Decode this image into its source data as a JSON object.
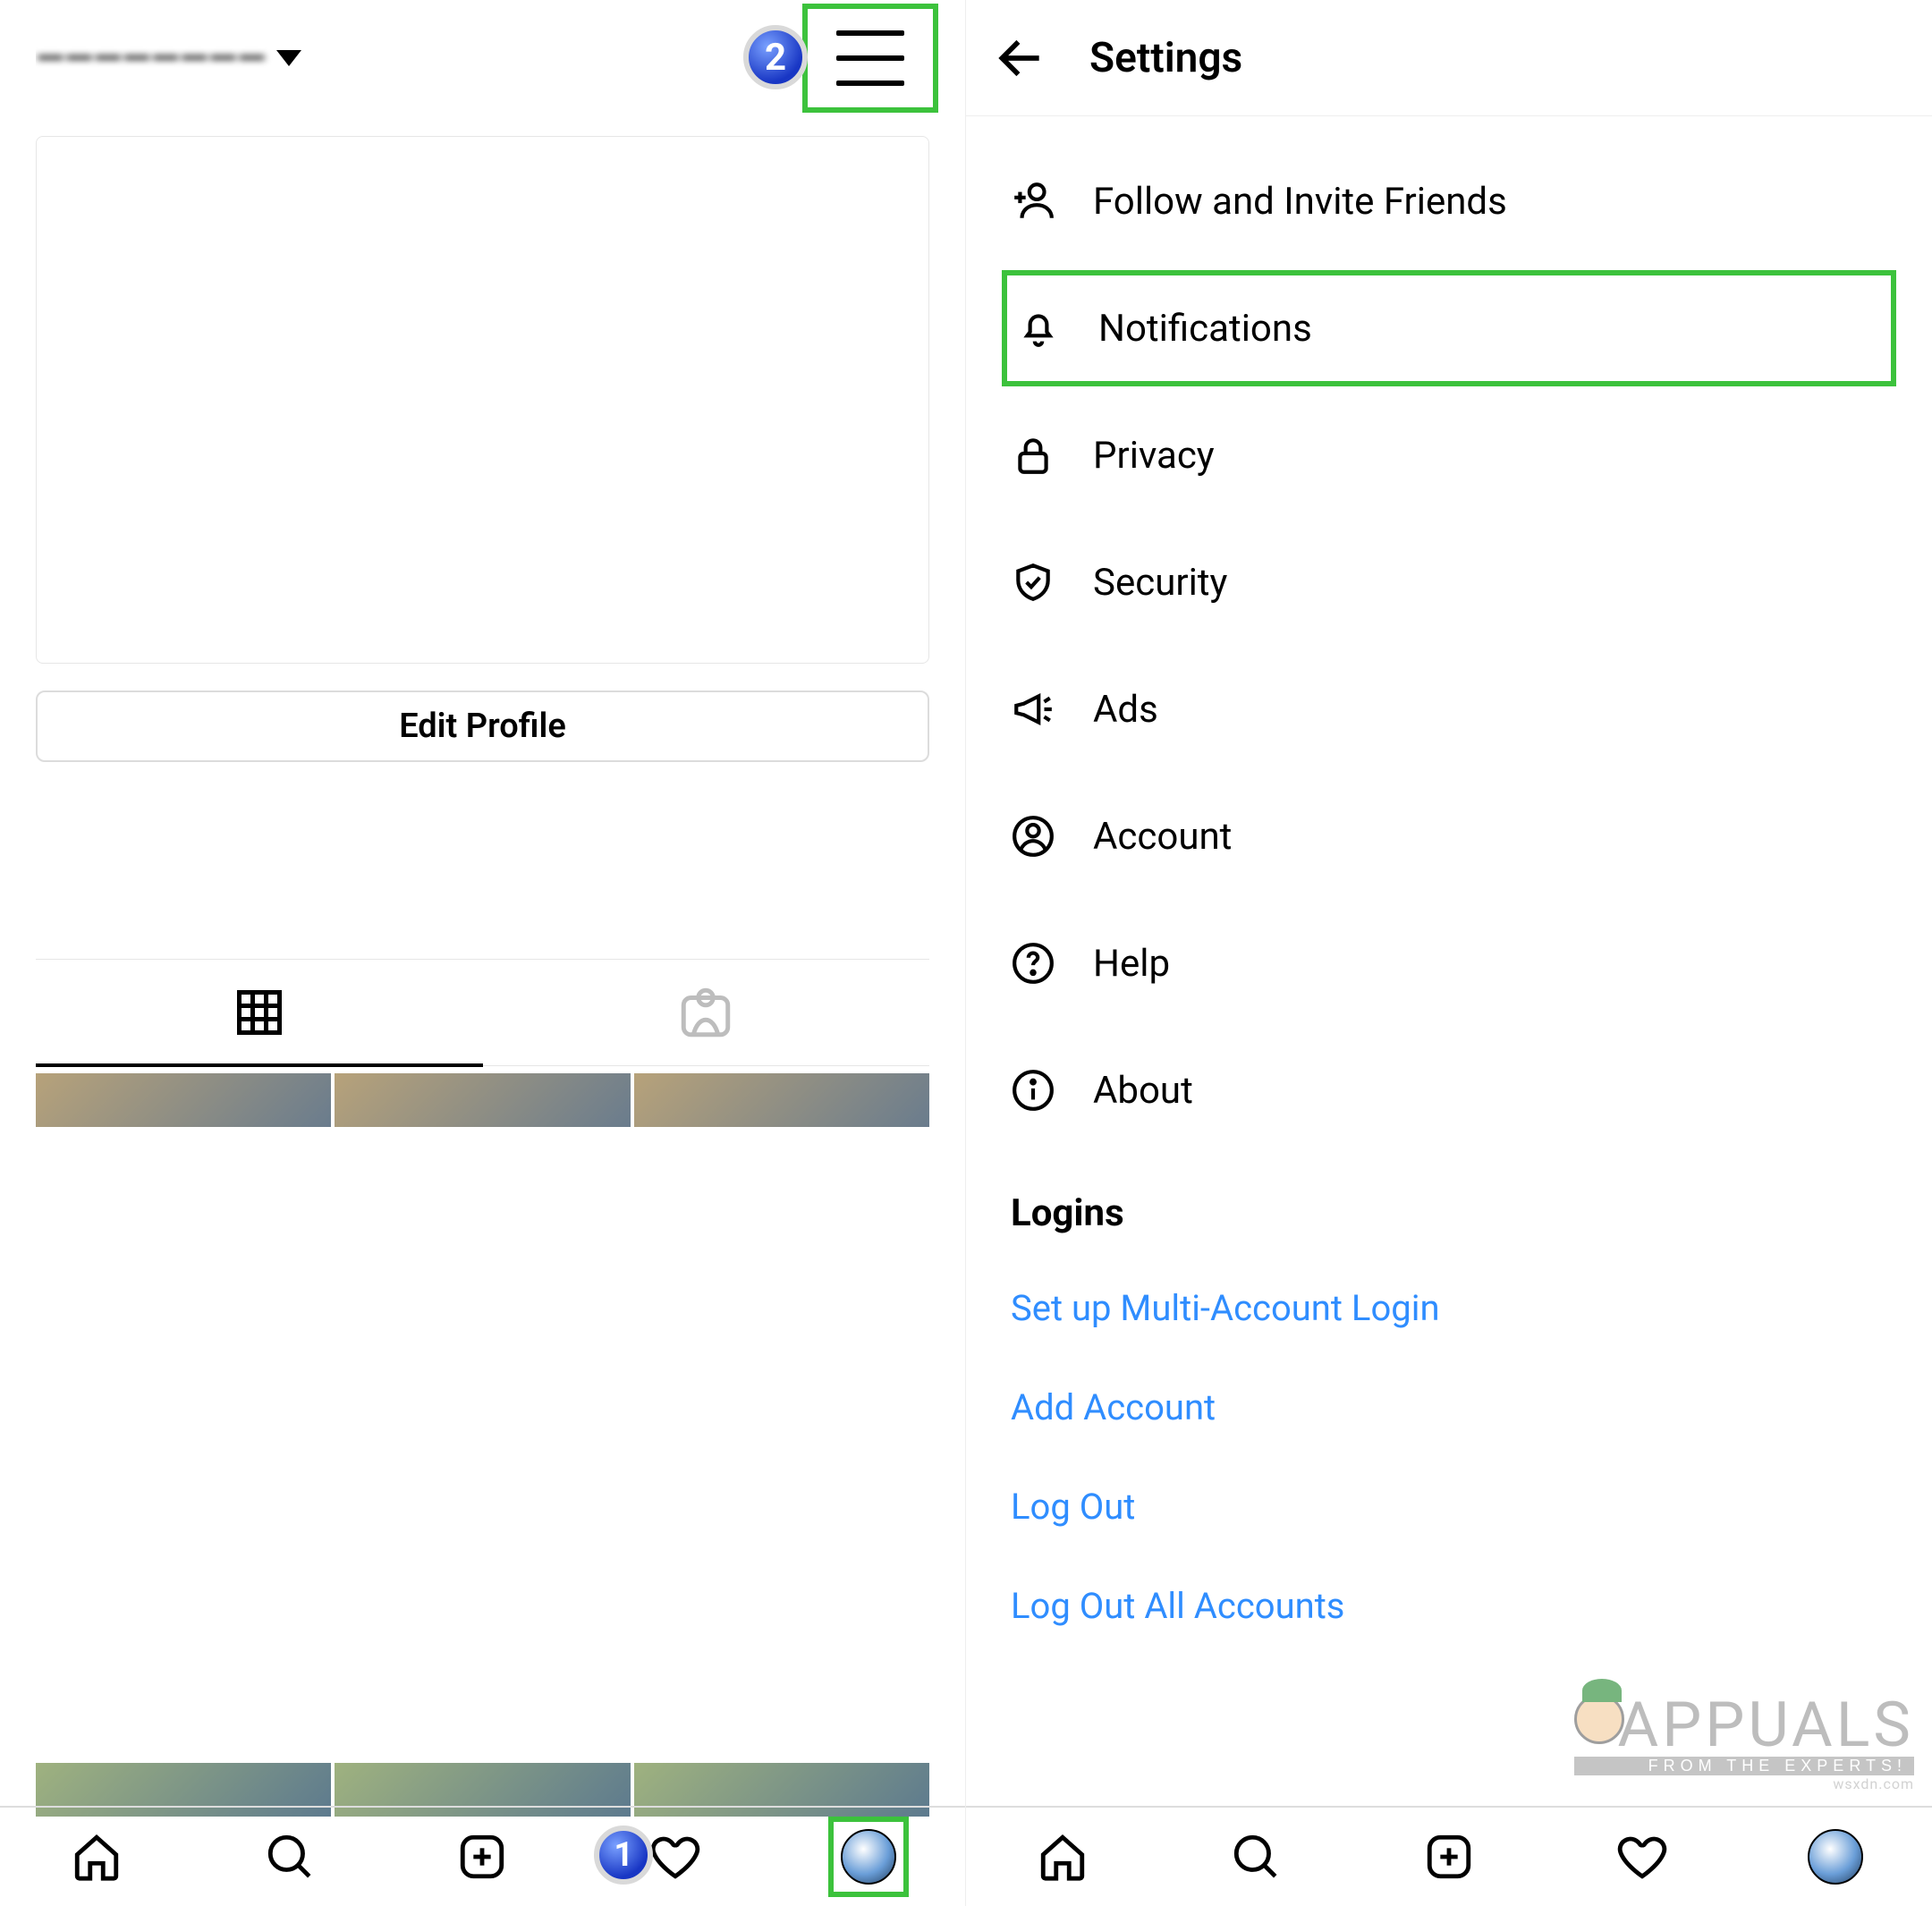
{
  "annotations": {
    "step1": "1",
    "step2": "2"
  },
  "profile": {
    "username": "————————",
    "edit_profile_label": "Edit Profile"
  },
  "settings": {
    "title": "Settings",
    "items": [
      {
        "id": "follow-invite",
        "label": "Follow and Invite Friends"
      },
      {
        "id": "notifications",
        "label": "Notifications"
      },
      {
        "id": "privacy",
        "label": "Privacy"
      },
      {
        "id": "security",
        "label": "Security"
      },
      {
        "id": "ads",
        "label": "Ads"
      },
      {
        "id": "account",
        "label": "Account"
      },
      {
        "id": "help",
        "label": "Help"
      },
      {
        "id": "about",
        "label": "About"
      }
    ],
    "logins_section_title": "Logins",
    "login_links": [
      "Set up Multi-Account Login",
      "Add Account",
      "Log Out",
      "Log Out All Accounts"
    ]
  },
  "watermark": {
    "brand": "APPUALS",
    "tagline": "FROM THE EXPERTS!",
    "site": "wsxdn.com"
  }
}
